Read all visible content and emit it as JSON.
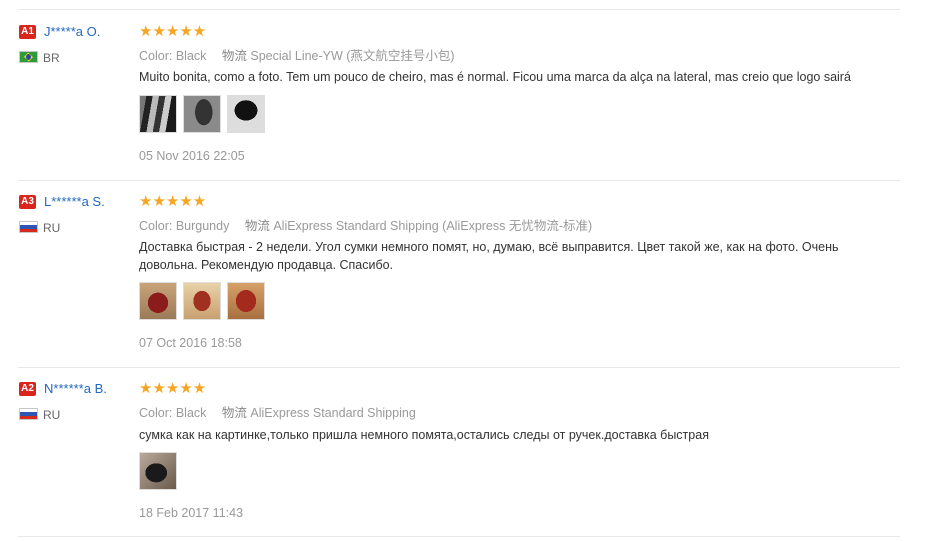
{
  "reviews": [
    {
      "badge": "A1",
      "name": "J*****a O.",
      "country_code": "BR",
      "stars": "★★★★★",
      "color_label": "Color:",
      "color_value": "Black",
      "shipping_label": "物流",
      "shipping_value": "Special Line-YW (燕文航空挂号小包)",
      "text": "Muito bonita, como a foto. Tem um pouco de cheiro, mas é normal. Ficou uma marca da alça na lateral, mas creio que logo sairá",
      "date": "05 Nov 2016 22:05"
    },
    {
      "badge": "A3",
      "name": "L******a S.",
      "country_code": "RU",
      "stars": "★★★★★",
      "color_label": "Color:",
      "color_value": "Burgundy",
      "shipping_label": "物流",
      "shipping_value": "AliExpress Standard Shipping (AliExpress 无忧物流-标准)",
      "text": "Доставка быстрая - 2 недели. Угол сумки немного помят, но, думаю, всё выправится. Цвет такой же, как на фото. Очень довольна. Рекомендую продавца. Спасибо.",
      "date": "07 Oct 2016 18:58"
    },
    {
      "badge": "A2",
      "name": "N******a B.",
      "country_code": "RU",
      "stars": "★★★★★",
      "color_label": "Color:",
      "color_value": "Black",
      "shipping_label": "物流",
      "shipping_value": "AliExpress Standard Shipping",
      "text": "сумка как на картинке,только пришла немного помята,остались следы от ручек.доставка быстрая",
      "date": "18 Feb 2017 11:43"
    }
  ],
  "colors": {
    "badge": "#d9261c",
    "name": "#2268c1",
    "stars": "#f5a623",
    "muted": "#999999"
  }
}
